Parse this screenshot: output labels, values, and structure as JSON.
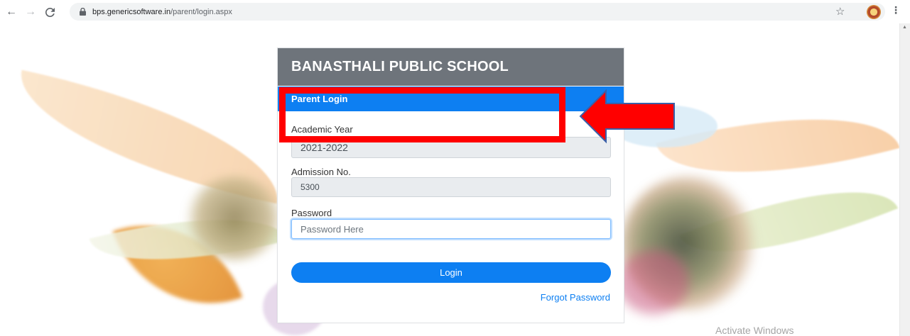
{
  "browser": {
    "url_host": "bps.genericsoftware.in",
    "url_path": "/parent/login.aspx"
  },
  "card": {
    "school_name": "BANASTHALI PUBLIC SCHOOL",
    "subtitle": "Parent Login"
  },
  "form": {
    "academic_year_label": "Academic Year",
    "academic_year_value": "2021-2022",
    "admission_label": "Admission No.",
    "admission_value": "5300",
    "password_label": "Password",
    "password_placeholder": "Password Here",
    "login_label": "Login",
    "forgot_label": "Forgot Password"
  },
  "overlay": {
    "watermark": "Activate Windows"
  },
  "colors": {
    "primary": "#0d7ff2",
    "header": "#6e747b",
    "highlight": "#ff0000"
  },
  "icons": [
    "back-arrow-icon",
    "forward-arrow-icon",
    "reload-icon",
    "lock-icon",
    "star-icon",
    "profile-avatar",
    "menu-dots-icon"
  ]
}
